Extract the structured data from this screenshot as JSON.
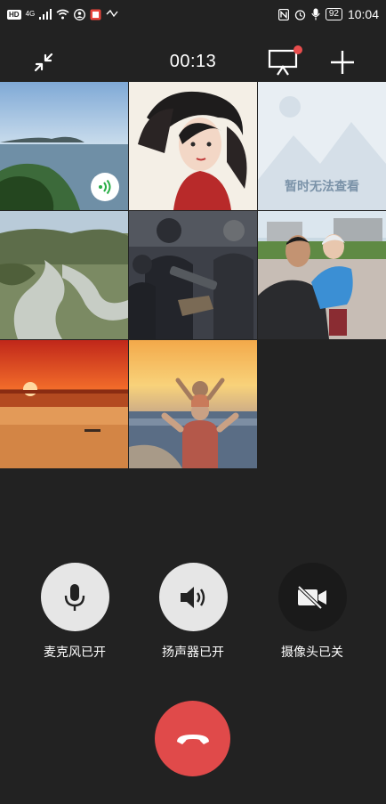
{
  "status_bar": {
    "hd_badge": "HD",
    "network_type": "4G",
    "battery_level": "92",
    "time": "10:04"
  },
  "call": {
    "duration": "00:13"
  },
  "participants": [
    {
      "name": "participant-1",
      "speaking": true
    },
    {
      "name": "participant-2",
      "speaking": false
    },
    {
      "name": "participant-3",
      "speaking": false,
      "placeholder_text": "暂时无法查看"
    },
    {
      "name": "participant-4",
      "speaking": false
    },
    {
      "name": "participant-5",
      "speaking": false
    },
    {
      "name": "participant-6",
      "speaking": false
    },
    {
      "name": "participant-7",
      "speaking": false
    },
    {
      "name": "participant-8",
      "speaking": false
    }
  ],
  "controls": {
    "mic": {
      "label": "麦克风已开",
      "icon": "microphone-icon"
    },
    "speaker": {
      "label": "扬声器已开",
      "icon": "speaker-icon"
    },
    "camera": {
      "label": "摄像头已关",
      "icon": "camera-off-icon"
    },
    "hangup": {
      "icon": "hangup-icon"
    }
  },
  "colors": {
    "background": "#222222",
    "control_on": "#e6e6e6",
    "control_off": "#1a1a1a",
    "hangup": "#e04a4a",
    "notification_dot": "#e84d4d",
    "speaking_indicator": "#2aae47"
  }
}
